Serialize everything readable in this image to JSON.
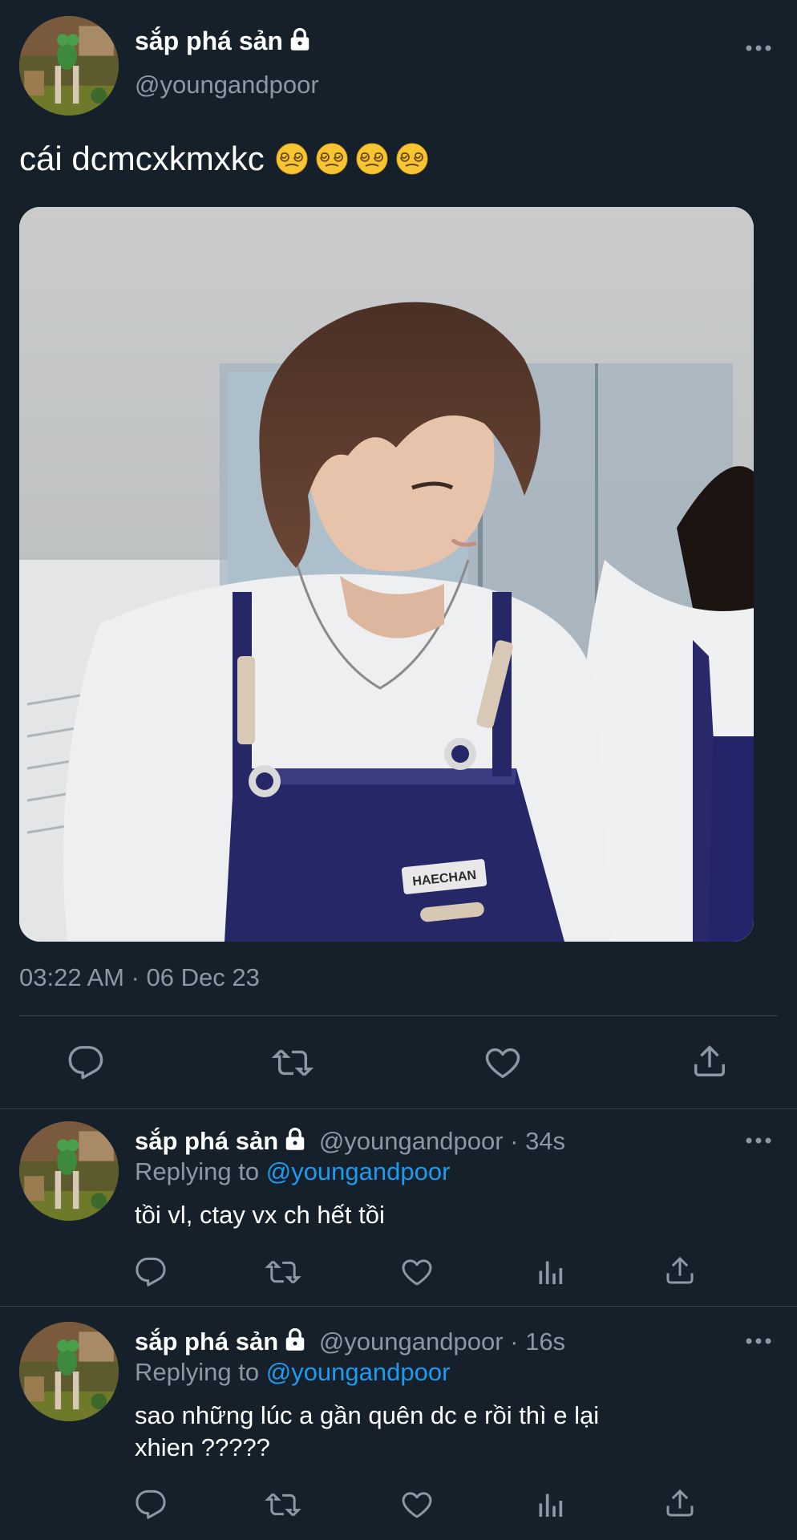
{
  "main_tweet": {
    "display_name": "sắp phá sản",
    "handle": "@youngandpoor",
    "text": "cái dcmcxkmxkc",
    "emojis": [
      "face-with-spiral-eyes",
      "face-with-spiral-eyes",
      "face-with-spiral-eyes",
      "face-with-spiral-eyes"
    ],
    "image_badge_text": "HAECHAN",
    "timestamp": "03:22 AM · 06 Dec 23",
    "actions": [
      "reply-icon",
      "retweet-icon",
      "like-icon",
      "share-icon"
    ]
  },
  "replies": [
    {
      "display_name": "sắp phá sản",
      "handle": "@youngandpoor",
      "time": "· 34s",
      "replying_prefix": "Replying to",
      "replying_to": "@youngandpoor",
      "text": "tồi vl, ctay vx ch hết tồi",
      "actions": [
        "reply-icon",
        "retweet-icon",
        "like-icon",
        "analytics-icon",
        "share-icon"
      ]
    },
    {
      "display_name": "sắp phá sản",
      "handle": "@youngandpoor",
      "time": "· 16s",
      "replying_prefix": "Replying to",
      "replying_to": "@youngandpoor",
      "text_line1": "sao những lúc a gần quên dc e rồi thì e lại",
      "text_line2": "xhien ?????",
      "actions": [
        "reply-icon",
        "retweet-icon",
        "like-icon",
        "analytics-icon",
        "share-icon"
      ]
    }
  ],
  "colors": {
    "background": "#15202b",
    "secondary_text": "#8b98a5",
    "link": "#1d9bf0",
    "divider": "#38444d"
  }
}
